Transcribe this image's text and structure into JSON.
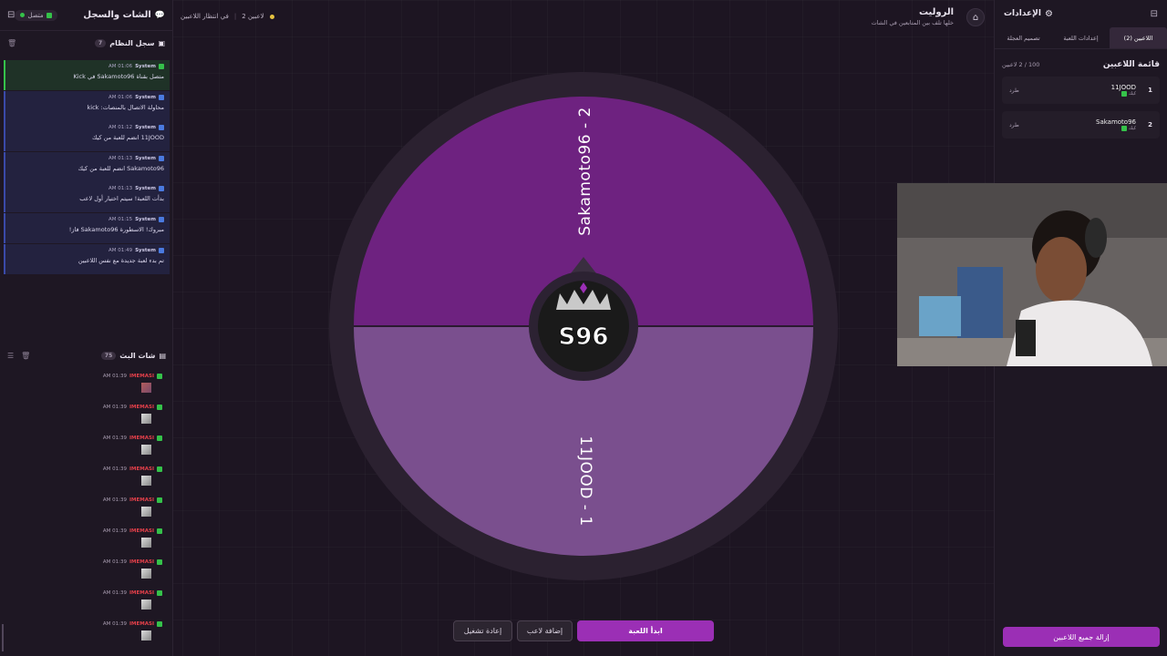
{
  "left_panel": {
    "title": "الشات والسجل",
    "status": "متصل",
    "system_log": {
      "title": "سجل النظام",
      "count": "7",
      "entries": [
        {
          "sender": "System",
          "time": "01:06 AM",
          "text": "متصل بقناة Sakamoto96 في Kick"
        },
        {
          "sender": "System",
          "time": "01:06 AM",
          "text": "محاولة الاتصال بالمنصات: kick"
        },
        {
          "sender": "System",
          "time": "01:12 AM",
          "text": "11JOOD انضم للعبة من كيك"
        },
        {
          "sender": "System",
          "time": "01:13 AM",
          "text": "Sakamoto96 انضم للعبة من كيك"
        },
        {
          "sender": "System",
          "time": "01:13 AM",
          "text": "بدأت اللعبة! سيتم اختيار أول لاعب"
        },
        {
          "sender": "System",
          "time": "01:15 AM",
          "text": "مبروك! الاسطورة Sakamoto96 فاز!"
        },
        {
          "sender": "System",
          "time": "01:49 AM",
          "text": "تم بدء لعبة جديدة مع نفس اللاعبين"
        }
      ]
    },
    "live_chat": {
      "title": "شات البث",
      "count": "75",
      "messages": [
        {
          "user": "IMEMASI",
          "time": "01:39 AM"
        },
        {
          "user": "IMEMASI",
          "time": "01:39 AM"
        },
        {
          "user": "IMEMASI",
          "time": "01:39 AM"
        },
        {
          "user": "IMEMASI",
          "time": "01:39 AM"
        },
        {
          "user": "IMEMASI",
          "time": "01:39 AM"
        },
        {
          "user": "IMEMASI",
          "time": "01:39 AM"
        },
        {
          "user": "IMEMASI",
          "time": "01:39 AM"
        },
        {
          "user": "IMEMASI",
          "time": "01:39 AM"
        },
        {
          "user": "IMEMASI",
          "time": "01:39 AM"
        }
      ]
    }
  },
  "header": {
    "title": "الروليت",
    "subtitle": "خلها تلف بين المتابعين في الشات",
    "players_count": "2 لاعبين",
    "waiting": "في انتظار اللاعبين"
  },
  "wheel": {
    "segments": [
      {
        "label": "Sakamoto96 - 2",
        "color": "#6e2280"
      },
      {
        "label": "11JOOD - 1",
        "color": "#7a4f8e"
      }
    ],
    "logo_text": "S96"
  },
  "controls": {
    "start": "ابدأ اللعبة",
    "add_player": "إضافة لاعب",
    "restart": "إعادة تشغيل"
  },
  "right_panel": {
    "title": "الإعدادات",
    "tabs": [
      "اللاعبين (2)",
      "إعدادات اللعبة",
      "تصميم العجلة"
    ],
    "player_list_title": "قائمة اللاعبين",
    "player_list_count": "100 / 2 لاعبين",
    "players": [
      {
        "num": "1",
        "name": "11JOOD",
        "platform": "كيك",
        "action": "طرد"
      },
      {
        "num": "2",
        "name": "Sakamoto96",
        "platform": "كيك",
        "action": "طرد"
      }
    ],
    "remove_all": "إزالة جميع اللاعبين"
  }
}
